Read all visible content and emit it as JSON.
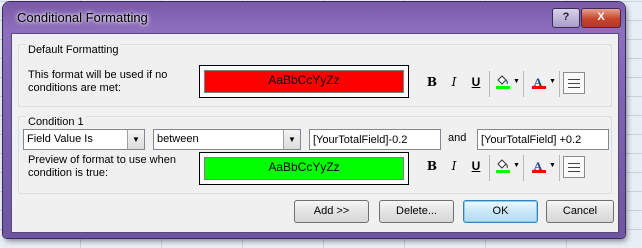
{
  "window": {
    "title": "Conditional Formatting",
    "help_label": "?",
    "close_label": "X"
  },
  "default_group": {
    "title": "Default Formatting",
    "description": "This format will be used if no conditions are met:",
    "preview_text": "AaBbCcYyZz",
    "preview_color": "#ff0000"
  },
  "condition_group": {
    "title": "Condition 1",
    "field_select": "Field Value Is",
    "operator_select": "between",
    "value1": "[YourTotalField]-0.2",
    "and_label": "and",
    "value2": "[YourTotalField] +0.2",
    "preview_label": "Preview of format to use when condition is true:",
    "preview_text": "AaBbCcYyZz",
    "preview_color": "#00ff00"
  },
  "format_toolbar": {
    "bold_label": "B",
    "italic_label": "I",
    "underline_label": "U",
    "fill_icon": "paint-bucket-icon",
    "font_color_label": "A",
    "fill_color": "#00ff00",
    "font_color": "#ff0000",
    "border_icon": "borders-icon"
  },
  "buttons": {
    "add": "Add >>",
    "delete": "Delete...",
    "ok": "OK",
    "cancel": "Cancel"
  }
}
